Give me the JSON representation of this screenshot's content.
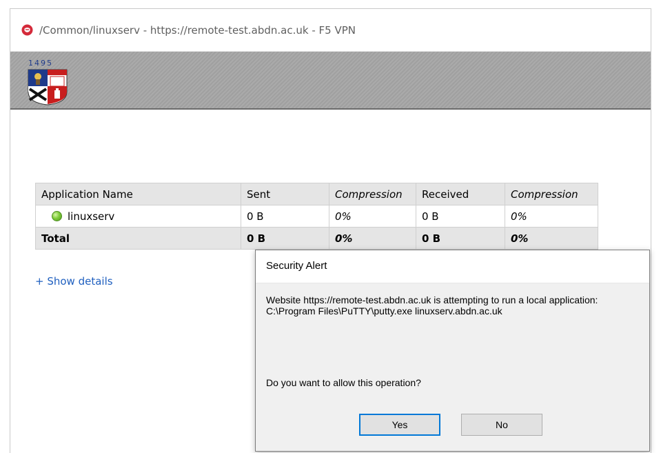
{
  "window": {
    "title": "/Common/linuxserv - https://remote-test.abdn.ac.uk - F5 VPN"
  },
  "header": {
    "crest_year": "1495"
  },
  "table": {
    "headers": [
      "Application Name",
      "Sent",
      "Compression",
      "Received",
      "Compression"
    ],
    "rows": [
      {
        "name": "linuxserv",
        "sent": "0 B",
        "sent_compression": "0%",
        "received": "0 B",
        "received_compression": "0%"
      }
    ],
    "total": {
      "label": "Total",
      "sent": "0 B",
      "sent_compression": "0%",
      "received": "0 B",
      "received_compression": "0%"
    }
  },
  "show_details": "+ Show details",
  "dialog": {
    "title": "Security Alert",
    "message_line1": "Website https://remote-test.abdn.ac.uk is attempting to run a local application:",
    "message_line2": "C:\\Program Files\\PuTTY\\putty.exe linuxserv.abdn.ac.uk",
    "question": "Do you want to allow this operation?",
    "yes_label": "Yes",
    "no_label": "No"
  },
  "colors": {
    "link": "#1f5fbf",
    "status_ok": "#7fcc3a",
    "focus_border": "#0078d7",
    "app_icon": "#d42a3a"
  }
}
